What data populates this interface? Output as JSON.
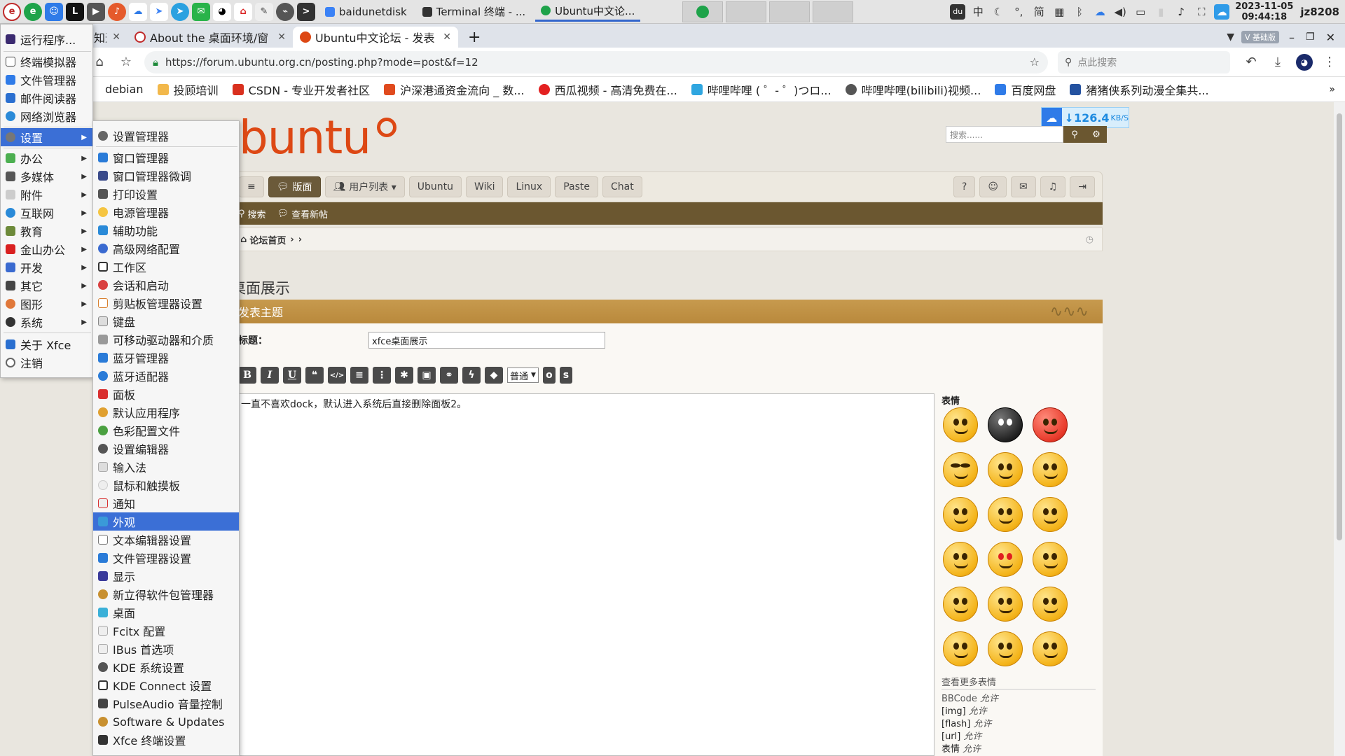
{
  "taskbar": {
    "tasks": [
      {
        "label": "baidunetdisk",
        "color": "#3b82f6"
      },
      {
        "label": "Terminal 终端 - ...",
        "color": "#333333"
      },
      {
        "label": "Ubuntu中文论...",
        "color": "#1ea34a"
      }
    ],
    "tray": {
      "ime": "中",
      "moon": "☾",
      "punct": "°,",
      "jian": "简",
      "clock_date": "2023-11-05",
      "clock_time": "09:44:18",
      "user": "jz8208"
    }
  },
  "browser": {
    "tabs": [
      {
        "label": "知道搜索_linux she",
        "active": false
      },
      {
        "label": "About the 桌面环境/窗",
        "active": false
      },
      {
        "label": "Ubuntu中文论坛 - 发表",
        "active": true
      }
    ],
    "new_tab": "+",
    "badge": "V 基础版",
    "url": "https://forum.ubuntu.org.cn/posting.php?mode=post&f=12",
    "search_placeholder": "点此搜索",
    "bookmarks": [
      {
        "label": "debian",
        "color": "#555555"
      },
      {
        "label": "投顾培训",
        "color": "#f2b84b"
      },
      {
        "label": "CSDN - 专业开发者社区",
        "color": "#d9301e"
      },
      {
        "label": "沪深港通资金流向 _ 数...",
        "color": "#e04a1e"
      },
      {
        "label": "西瓜视频 - 高清免费在...",
        "color": "#e32020"
      },
      {
        "label": "哔哩哔哩 ( ゜- ゜)つロ...",
        "color": "#2fa6e0"
      },
      {
        "label": "哔哩哔哩(bilibili)视频...",
        "color": "#555555"
      },
      {
        "label": "百度网盘",
        "color": "#2f7be8"
      },
      {
        "label": "猪猪侠系列动漫全集共...",
        "color": "#2452a0"
      }
    ]
  },
  "speed_widget": {
    "value": "↓126.4",
    "unit": "KB/S"
  },
  "forum": {
    "logo": "ubuntu",
    "search_placeholder": "搜索......",
    "nav": [
      {
        "label": "≡",
        "active": false
      },
      {
        "label": "版面",
        "active": true
      },
      {
        "label": "用户列表 ▾",
        "active": false
      },
      {
        "label": "Ubuntu",
        "active": false
      },
      {
        "label": "Wiki",
        "active": false
      },
      {
        "label": "Linux",
        "active": false
      },
      {
        "label": "Paste",
        "active": false
      },
      {
        "label": "Chat",
        "active": false
      }
    ],
    "nav_right_icons": [
      "help-icon",
      "user-icon",
      "inbox-icon",
      "bell-icon",
      "logout-icon"
    ],
    "subnav": [
      {
        "label": "搜索"
      },
      {
        "label": "查看新帖"
      }
    ],
    "breadcrumb": "论坛首页",
    "page_title": "桌面展示",
    "post_header": "发表主题",
    "subject_label": "标题：",
    "subject_value": "xfce桌面展示",
    "editor_buttons": [
      "B",
      "I",
      "U",
      "❝",
      "</>",
      "≡",
      "⋮",
      "✱",
      "▣",
      "⚭",
      "ϟ",
      "◆"
    ],
    "size_select": "普通",
    "editor_extra": [
      "o",
      "s"
    ],
    "message": "一直不喜欢dock，默认进入系统后直接删除面板2。",
    "smilies_title": "表情",
    "more_smilies": "查看更多表情",
    "bbcode_info": [
      {
        "name": "BBCode",
        "status": "允许"
      },
      {
        "name": "[img]",
        "status": "允许"
      },
      {
        "name": "[flash]",
        "status": "允许"
      },
      {
        "name": "[url]",
        "status": "允许"
      },
      {
        "name": "表情",
        "status": "允许"
      }
    ]
  },
  "app_menu": {
    "items": [
      {
        "label": "运行程序...",
        "color": "#3b2a70",
        "submenu": false
      },
      {
        "label": "终端模拟器",
        "color": "#444444",
        "submenu": false
      },
      {
        "label": "文件管理器",
        "color": "#2f7be8",
        "submenu": false
      },
      {
        "label": "邮件阅读器",
        "color": "#2a6fd0",
        "submenu": false
      },
      {
        "label": "网络浏览器",
        "color": "#2a8ad8",
        "submenu": false
      },
      {
        "label": "设置",
        "color": "#777777",
        "submenu": true,
        "highlighted": true
      },
      {
        "label": "办公",
        "color": "#4caf50",
        "submenu": true
      },
      {
        "label": "多媒体",
        "color": "#555555",
        "submenu": true
      },
      {
        "label": "附件",
        "color": "#cccccc",
        "submenu": true
      },
      {
        "label": "互联网",
        "color": "#2a8ad8",
        "submenu": true
      },
      {
        "label": "教育",
        "color": "#6d8a3a",
        "submenu": true
      },
      {
        "label": "金山办公",
        "color": "#d92020",
        "submenu": true
      },
      {
        "label": "开发",
        "color": "#3a6ad0",
        "submenu": true
      },
      {
        "label": "其它",
        "color": "#444444",
        "submenu": true
      },
      {
        "label": "图形",
        "color": "#e0783a",
        "submenu": true
      },
      {
        "label": "系统",
        "color": "#333333",
        "submenu": true
      },
      {
        "label": "关于 Xfce",
        "color": "#2a6fd0",
        "submenu": false
      },
      {
        "label": "注销",
        "color": "#666666",
        "submenu": false
      }
    ]
  },
  "settings_menu": {
    "items": [
      {
        "label": "设置管理器",
        "color": "#666666"
      },
      {
        "label": "窗口管理器",
        "color": "#2a7bd8"
      },
      {
        "label": "窗口管理器微调",
        "color": "#3a4a8a"
      },
      {
        "label": "打印设置",
        "color": "#555555"
      },
      {
        "label": "电源管理器",
        "color": "#f5c542"
      },
      {
        "label": "辅助功能",
        "color": "#2a8ad8"
      },
      {
        "label": "高级网络配置",
        "color": "#3a6ad0"
      },
      {
        "label": "工作区",
        "color": "#333333"
      },
      {
        "label": "会话和启动",
        "color": "#d94040"
      },
      {
        "label": "剪贴板管理器设置",
        "color": "#d98030"
      },
      {
        "label": "键盘",
        "color": "#888888"
      },
      {
        "label": "可移动驱动器和介质",
        "color": "#999999"
      },
      {
        "label": "蓝牙管理器",
        "color": "#2a7bd8"
      },
      {
        "label": "蓝牙适配器",
        "color": "#2a7bd8"
      },
      {
        "label": "面板",
        "color": "#d93030"
      },
      {
        "label": "默认应用程序",
        "color": "#e0a030"
      },
      {
        "label": "色彩配置文件",
        "color": "#4aa040"
      },
      {
        "label": "设置编辑器",
        "color": "#555555"
      },
      {
        "label": "输入法",
        "color": "#aaaaaa"
      },
      {
        "label": "鼠标和触摸板",
        "color": "#cccccc"
      },
      {
        "label": "通知",
        "color": "#d93030"
      },
      {
        "label": "外观",
        "color": "#3a9ad8",
        "highlighted": true
      },
      {
        "label": "文本编辑器设置",
        "color": "#777777"
      },
      {
        "label": "文件管理器设置",
        "color": "#2a7bd8"
      },
      {
        "label": "显示",
        "color": "#3a3a9a"
      },
      {
        "label": "新立得软件包管理器",
        "color": "#c89030"
      },
      {
        "label": "桌面",
        "color": "#3ab0d8"
      },
      {
        "label": "Fcitx 配置",
        "color": "#bbbbbb"
      },
      {
        "label": "IBus 首选项",
        "color": "#bbbbbb"
      },
      {
        "label": "KDE 系统设置",
        "color": "#555555"
      },
      {
        "label": "KDE Connect 设置",
        "color": "#333333"
      },
      {
        "label": "PulseAudio 音量控制",
        "color": "#444444"
      },
      {
        "label": "Software & Updates",
        "color": "#c89030"
      },
      {
        "label": "Xfce 终端设置",
        "color": "#333333"
      }
    ]
  }
}
